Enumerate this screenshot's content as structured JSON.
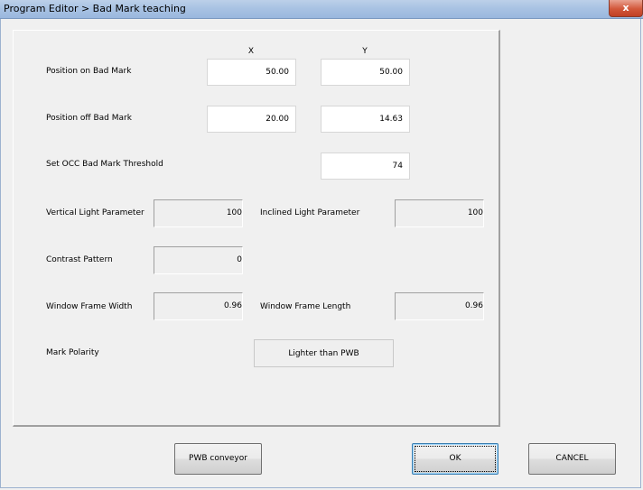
{
  "window": {
    "title": "Program Editor > Bad Mark teaching",
    "close_glyph": "x"
  },
  "panel": {
    "column_x": "X",
    "column_y": "Y",
    "position_on": {
      "label": "Position on Bad Mark",
      "x": "50.00",
      "y": "50.00"
    },
    "position_off": {
      "label": "Position off Bad Mark",
      "x": "20.00",
      "y": "14.63"
    },
    "occ_threshold": {
      "label": "Set OCC Bad Mark Threshold",
      "value": "74"
    },
    "vertical_light": {
      "label": "Vertical Light Parameter",
      "value": "100"
    },
    "inclined_light": {
      "label": "Inclined Light Parameter",
      "value": "100"
    },
    "contrast_pattern": {
      "label": "Contrast Pattern",
      "value": "0"
    },
    "window_frame_width": {
      "label": "Window Frame Width",
      "value": "0.96"
    },
    "window_frame_length": {
      "label": "Window Frame Length",
      "value": "0.96"
    },
    "mark_polarity": {
      "label": "Mark Polarity",
      "value": "Lighter than PWB"
    }
  },
  "buttons": {
    "pwb_conveyor": "PWB conveyor",
    "ok": "OK",
    "cancel": "CANCEL"
  }
}
